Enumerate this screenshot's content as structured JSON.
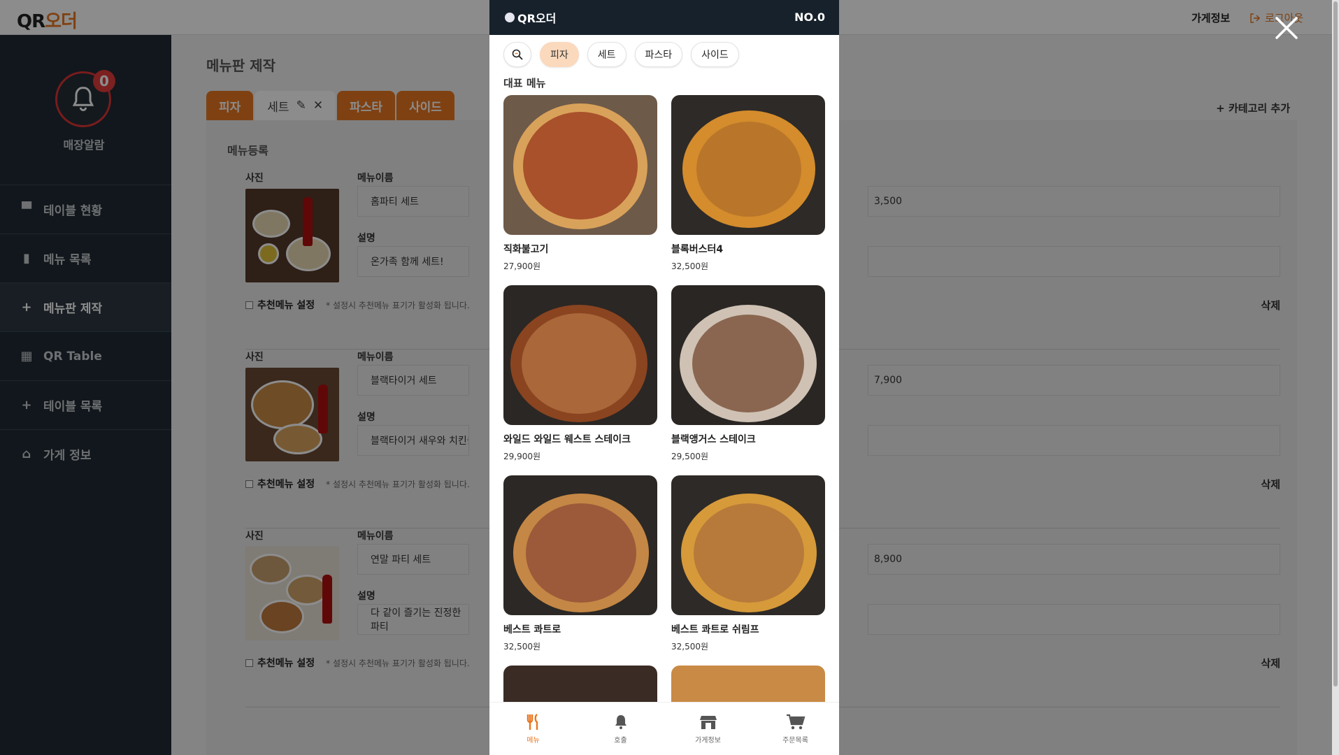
{
  "app": {
    "logo": {
      "q": "QR",
      "o": "오더"
    },
    "top_store": "가게정보",
    "top_logout": "로그아웃"
  },
  "sidebar": {
    "alarm_count": "0",
    "alarm_label": "매장알람",
    "items": [
      {
        "label": "테이블 현황",
        "icon": "table-icon"
      },
      {
        "label": "메뉴 목록",
        "icon": "book-icon"
      },
      {
        "label": "메뉴판 제작",
        "icon": "plus-icon"
      },
      {
        "label": "QR Table",
        "icon": "qr-icon"
      },
      {
        "label": "테이블 목록",
        "icon": "plus-icon"
      },
      {
        "label": "가게 정보",
        "icon": "store-icon"
      }
    ]
  },
  "main": {
    "title": "메뉴판 제작",
    "tabs": [
      "피자",
      "세트",
      "파스타",
      "사이드"
    ],
    "add_category": "카테고리 추가",
    "register_title": "메뉴등록",
    "labels": {
      "photo": "사진",
      "name": "메뉴이름",
      "desc": "설명",
      "recommend": "추천메뉴 설정",
      "recommend_note": "* 설정시 추천메뉴 표기가 활성화 됩니다.",
      "delete": "삭제"
    },
    "rows": [
      {
        "name": "홈파티 세트",
        "desc": "온가족 함께 세트!",
        "price": "3,500"
      },
      {
        "name": "블랙타이거 세트",
        "desc": "블랙타이거 새우와 치킨을 함께",
        "price": "7,900"
      },
      {
        "name": "연말 파티 세트",
        "desc": "다 같이 즐기는 진정한 파티",
        "price": "8,900"
      }
    ]
  },
  "preview": {
    "logo": "QR오더",
    "table_no": "NO.0",
    "chips": [
      "피자",
      "세트",
      "파스타",
      "사이드"
    ],
    "active_chip": "피자",
    "section_title": "대표 메뉴",
    "menu": [
      {
        "name": "직화불고기",
        "price": "27,900원"
      },
      {
        "name": "블록버스터4",
        "price": "32,500원"
      },
      {
        "name": "와일드 와일드 웨스트 스테이크",
        "price": "29,900원"
      },
      {
        "name": "블랙앵거스 스테이크",
        "price": "29,500원"
      },
      {
        "name": "베스트 콰트로",
        "price": "32,500원"
      },
      {
        "name": "베스트 콰트로 쉬림프",
        "price": "32,500원"
      }
    ],
    "nav": [
      {
        "label": "메뉴",
        "icon": "fork-knife-icon"
      },
      {
        "label": "호출",
        "icon": "bell-icon"
      },
      {
        "label": "가게정보",
        "icon": "store-icon"
      },
      {
        "label": "주문목록",
        "icon": "cart-icon"
      }
    ]
  },
  "colors": {
    "accent": "#e87722",
    "sidebar": "#1f2a33",
    "header": "#16212b"
  }
}
